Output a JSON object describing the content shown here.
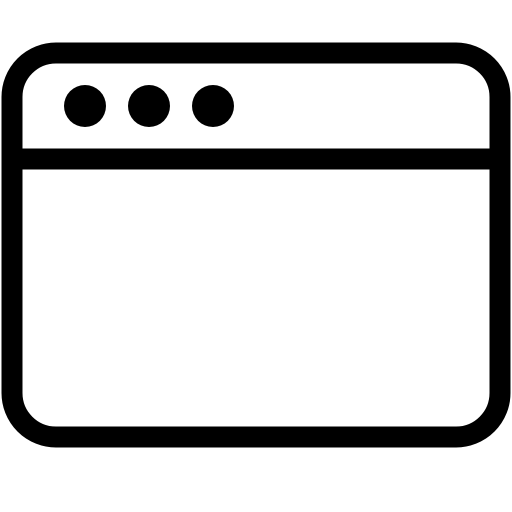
{
  "icon": {
    "name": "browser-window-icon",
    "description_semantic": "window",
    "colors": {
      "stroke": "#000000",
      "fill": "#ffffff"
    },
    "dots_count": 3
  }
}
